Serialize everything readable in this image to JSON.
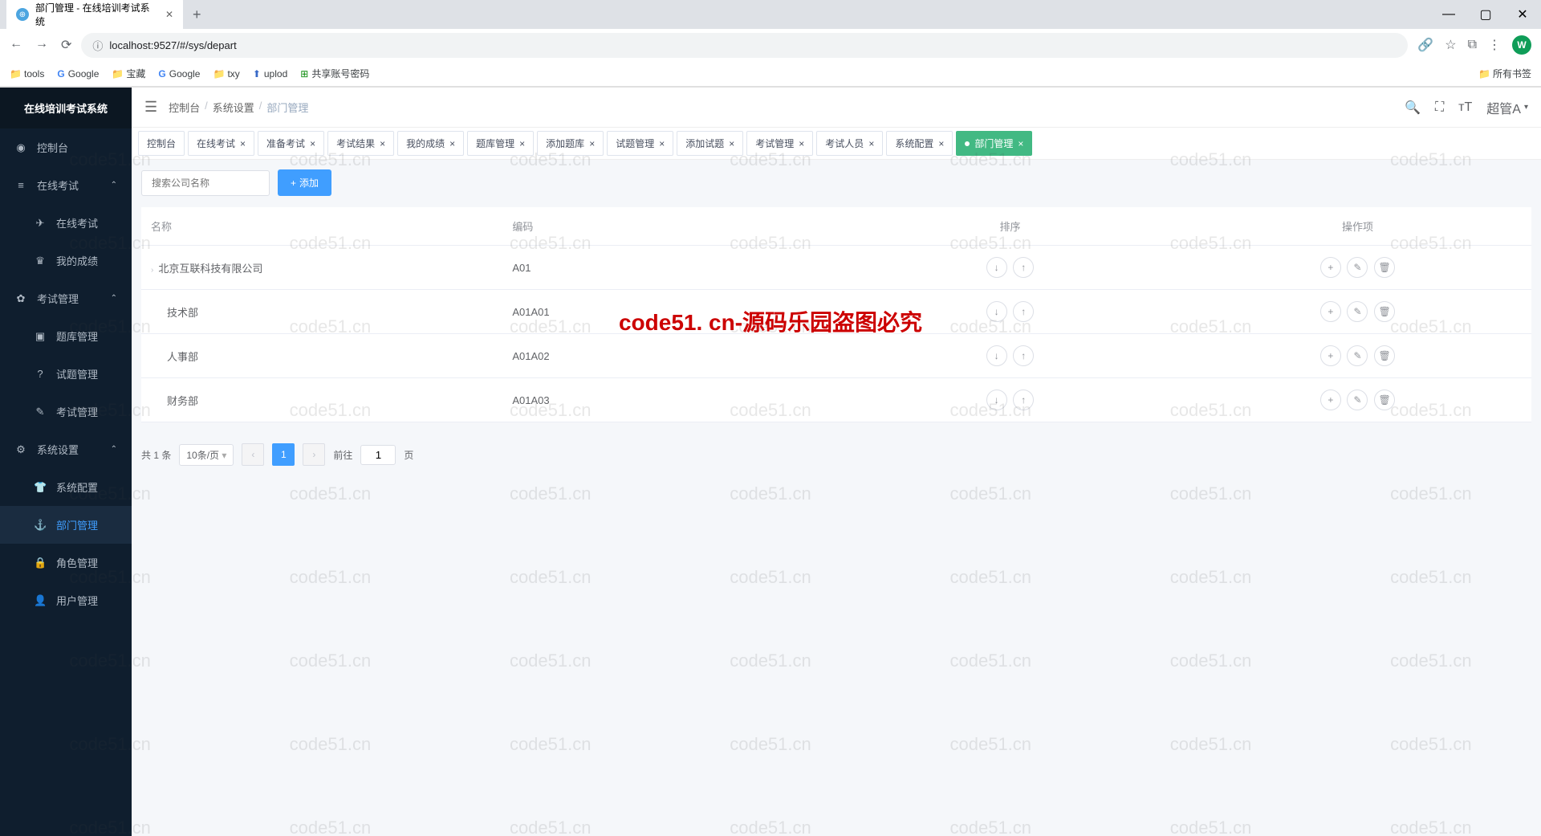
{
  "browser": {
    "tab_title": "部门管理 - 在线培训考试系统",
    "url": "localhost:9527/#/sys/depart",
    "bookmarks": [
      "tools",
      "Google",
      "宝藏",
      "Google",
      "txy",
      "uplod",
      "共享账号密码"
    ],
    "all_bookmarks": "所有书签",
    "avatar_letter": "W"
  },
  "sidebar": {
    "logo": "在线培训考试系统",
    "items": [
      {
        "icon": "◉",
        "label": "控制台"
      },
      {
        "icon": "≡",
        "label": "在线考试",
        "expanded": true
      },
      {
        "icon": "✈",
        "label": "在线考试",
        "sub": true
      },
      {
        "icon": "♛",
        "label": "我的成绩",
        "sub": true
      },
      {
        "icon": "✿",
        "label": "考试管理",
        "expanded": true
      },
      {
        "icon": "▣",
        "label": "题库管理",
        "sub": true
      },
      {
        "icon": "?",
        "label": "试题管理",
        "sub": true
      },
      {
        "icon": "✎",
        "label": "考试管理",
        "sub": true
      },
      {
        "icon": "⚙",
        "label": "系统设置",
        "expanded": true
      },
      {
        "icon": "👕",
        "label": "系统配置",
        "sub": true
      },
      {
        "icon": "⚓",
        "label": "部门管理",
        "sub": true,
        "active": true
      },
      {
        "icon": "🔒",
        "label": "角色管理",
        "sub": true
      },
      {
        "icon": "👤",
        "label": "用户管理",
        "sub": true
      }
    ]
  },
  "header": {
    "breadcrumb": [
      "控制台",
      "系统设置",
      "部门管理"
    ],
    "user": "超管A"
  },
  "tabs": [
    "控制台",
    "在线考试",
    "准备考试",
    "考试结果",
    "我的成绩",
    "题库管理",
    "添加题库",
    "试题管理",
    "添加试题",
    "考试管理",
    "考试人员",
    "系统配置",
    "部门管理"
  ],
  "active_tab": "部门管理",
  "toolbar": {
    "search_placeholder": "搜索公司名称",
    "add_label": "添加"
  },
  "table": {
    "columns": [
      "名称",
      "编码",
      "排序",
      "操作项"
    ],
    "rows": [
      {
        "name": "北京互联科技有限公司",
        "code": "A01",
        "indent": 0,
        "expandable": true
      },
      {
        "name": "技术部",
        "code": "A01A01",
        "indent": 1
      },
      {
        "name": "人事部",
        "code": "A01A02",
        "indent": 1
      },
      {
        "name": "财务部",
        "code": "A01A03",
        "indent": 1
      }
    ]
  },
  "pagination": {
    "total": "共 1 条",
    "page_size": "10条/页",
    "goto_label": "前往",
    "current_page": "1",
    "page_suffix": "页"
  },
  "watermark": {
    "text": "code51.cn",
    "center": "code51. cn-源码乐园盗图必究"
  }
}
